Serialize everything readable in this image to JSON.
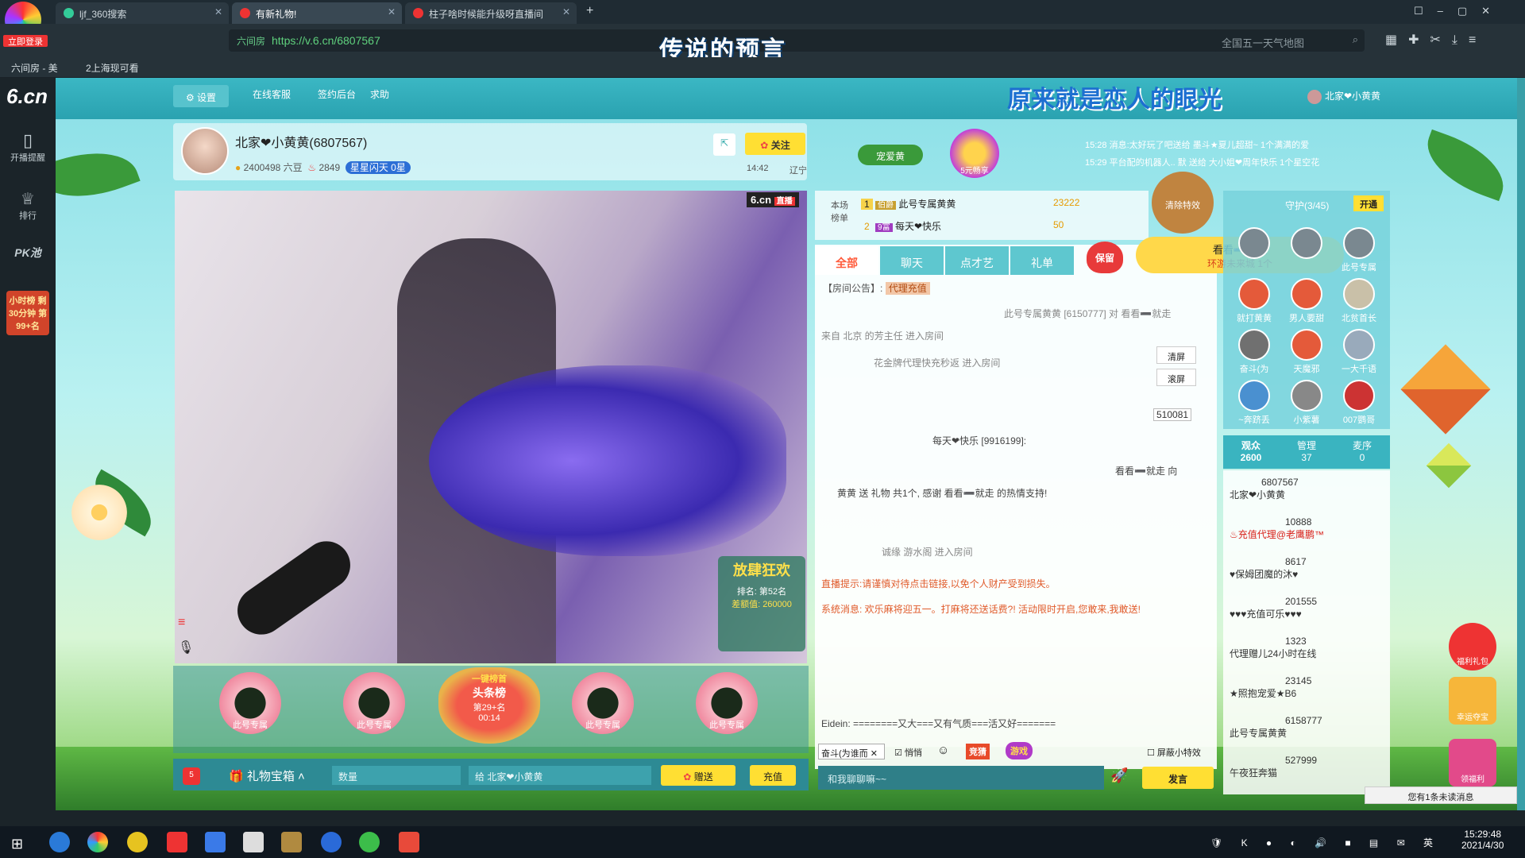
{
  "browser": {
    "tabs": [
      {
        "label": "ljf_360搜索"
      },
      {
        "label": "有新礼物!"
      },
      {
        "label": "柱子啥时候能升级呀直播间"
      }
    ],
    "login_label": "立即登录",
    "url": "https://v.6.cn/6807567",
    "url_badge": "六间房",
    "overlay_title": "传说的预言",
    "search_placeholder": "全国五一天气地图",
    "bookmarks": [
      "六间房 - 美",
      "2上海现可看"
    ]
  },
  "site": {
    "logo": "6.cn",
    "settings_label": "设置",
    "nav": [
      "在线客服",
      "签约后台",
      "求助"
    ],
    "banner_title": "原来就是恋人的眼光",
    "user_label": "北家❤小黄黄"
  },
  "leftbar": {
    "items": [
      "开播提醒",
      "排行",
      "PK池",
      "小时榜 剩30分钟 第99+名"
    ]
  },
  "anchor": {
    "name": "北家❤小黄黄(6807567)",
    "beans": "2400498 六豆",
    "fans": "2849",
    "star_label": "星星闪天 0星",
    "time": "14:42",
    "location": "辽宁",
    "follow_label": "关注",
    "favorite_label": "宠爱黄",
    "promo_label": "5元畅享"
  },
  "ticker": [
    {
      "time": "15:28",
      "text": "消息:太好玩了吧送给 墨斗★夏儿超甜~ 1个满满的爱"
    },
    {
      "time": "15:29",
      "text": "平台配的机器人.. 默 送给 大小姐❤周年快乐 1个星空花"
    }
  ],
  "rank": {
    "label": "本场榜单",
    "rows": [
      {
        "pos": "1",
        "badge": "伯爵",
        "name": "此号专属黄黄",
        "score": "23222"
      },
      {
        "pos": "2",
        "badge": "9富",
        "name": "每天❤快乐",
        "score": "50"
      }
    ],
    "clear_label": "清除特效"
  },
  "chat": {
    "tabs": [
      "全部",
      "聊天",
      "点才艺",
      "礼单"
    ],
    "save_label": "保留",
    "notice_label": "【房间公告】:",
    "notice_badge": "代理充值",
    "clear_btn": "清屏",
    "scroll_btn": "滚屏",
    "car_number": "510081",
    "lines": [
      "此号专属黄黄 [6150777] 对 看看➖就走",
      "来自 北京 的芳主任 进入房间",
      "花金牌代理快充秒返 进入房间",
      "每天❤快乐 [9916199]:",
      "看看➖就走 向",
      "黄黄 送 礼物 共1个, 感谢 看看➖就走 的热情支持!",
      "诚缘 游水阁 进入房间",
      "直播提示:请谨慎对待点击链接,以免个人财产受到损失。",
      "系统消息: 欢乐麻将迎五一。打麻将还送话费?! 活动限时开启,您敢来,我敢送!",
      "Eidein: ========又大===又有气质===活又好======="
    ],
    "effect_name": "看看➖就走",
    "effect_sub": "环游未来城 1个",
    "input_target": "奋斗(为谁而",
    "whisper_label": "悄悄",
    "hide_fx_label": "屏蔽小特效",
    "input_placeholder": "和我聊聊嘛~~",
    "send_label": "发言",
    "game_label": "游戏",
    "score_label": "竞猜"
  },
  "guards": {
    "title": "守护(3/45)",
    "open_label": "开通",
    "members": [
      "",
      "",
      "此号专属",
      "就打黄黄",
      "男人要甜",
      "北贫首长",
      "奋斗(为",
      "天魔邪",
      "一大千语",
      "~奔跻丢",
      "小紫薯",
      "007鹦哥"
    ],
    "tabs": [
      {
        "label": "观众",
        "count": "2600"
      },
      {
        "label": "管理",
        "count": "37"
      },
      {
        "label": "麦序",
        "count": "0"
      }
    ]
  },
  "viewers": [
    {
      "id": "6807567",
      "name": "北家❤小黄黄"
    },
    {
      "id": "10888",
      "name": "♨充值代理@老鹰鹏™"
    },
    {
      "id": "8617",
      "name": "♥保姆团魔的沐♥"
    },
    {
      "id": "201555",
      "name": "♥♥♥充值可乐♥♥♥"
    },
    {
      "id": "1323",
      "name": "代理赠儿24小时在线"
    },
    {
      "id": "23145",
      "name": "★照抱宠爱★B6"
    },
    {
      "id": "6158777",
      "name": "此号专属黄黄"
    },
    {
      "id": "527999",
      "name": "午夜狂奔猫"
    }
  ],
  "side_buttons": [
    "福利礼包",
    "幸运夺宝",
    "领福利"
  ],
  "toast": "您有1条未读消息",
  "video": {
    "logo": "6.cn",
    "live_badge": "直播",
    "event_title": "放肆狂欢",
    "event_rank": "排名: 第52名",
    "event_gap": "差额值: 260000"
  },
  "gifts": {
    "seats": [
      "此号专属",
      "此号专属",
      "此号专属",
      "此号专属"
    ],
    "center_title": "头条榜",
    "center_rank": "第29+名",
    "center_time": "00:14",
    "center_top": "一键榜首",
    "box_label": "礼物宝箱",
    "qty_label": "数量",
    "to_label": "给 北家❤小黄黄",
    "gift_label": "赠送",
    "recharge_label": "充值",
    "mail_count": "5"
  },
  "taskbar": {
    "time": "15:29:48",
    "date": "2021/4/30",
    "lang": "英"
  }
}
